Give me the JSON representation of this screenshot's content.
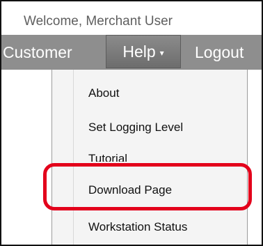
{
  "header": {
    "welcome": "Welcome, Merchant User"
  },
  "nav": {
    "customer": "Customer",
    "help": "Help",
    "help_caret": "▾",
    "logout": "Logout"
  },
  "help_menu": {
    "items": [
      {
        "label": "About"
      },
      {
        "label": "Set Logging Level"
      },
      {
        "label": "Tutorial"
      },
      {
        "label": "Download Page"
      },
      {
        "label": "Workstation Status"
      }
    ]
  },
  "colors": {
    "nav_background": "#8e8e8e",
    "highlight": "#e3001b"
  }
}
